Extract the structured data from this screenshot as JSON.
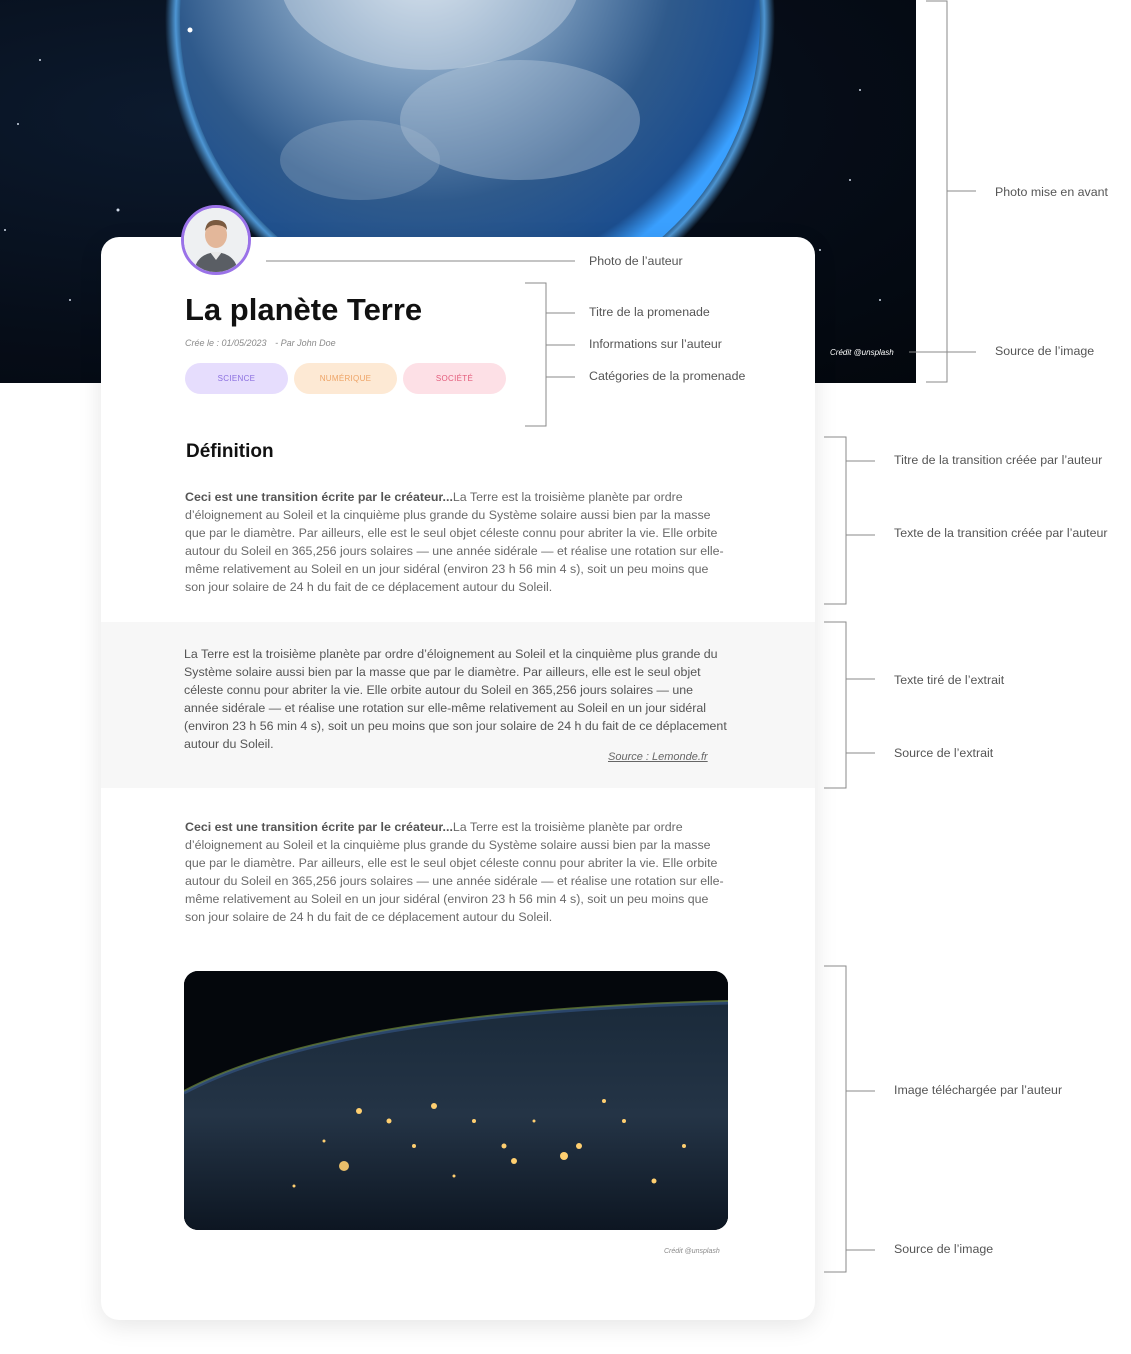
{
  "hero": {
    "credit": "Crédit @unsplash"
  },
  "card": {
    "title": "La planète Terre",
    "meta": {
      "created": "Crée le : 01/05/2023",
      "author": "- Par John Doe"
    },
    "tags": [
      "SCIENCE",
      "NUMÉRIQUE",
      "SOCIÉTÉ"
    ],
    "section_title": "Définition",
    "transition1": {
      "lead": "Ceci est une transition écrite par le créateur...",
      "body": "La Terre est la troisième planète par ordre d’éloignement au Soleil et la cinquième plus grande du Système solaire aussi bien par la masse  que par le diamètre. Par ailleurs, elle est le seul objet céleste connu pour abriter la vie. Elle orbite autour du Soleil en 365,256 jours solaires  — une année sidérale — et réalise une rotation sur elle-même relativement au Soleil en un jour sidéral (environ 23 h 56 min 4 s), soit un peu  moins que son jour solaire de 24 h du fait de ce déplacement autour du Soleil."
    },
    "extract": {
      "text": "La Terre est la troisième planète par ordre d’éloignement au Soleil et la cinquième plus grande du Système solaire aussi bien par la masse  que par le diamètre. Par ailleurs, elle est le seul objet céleste connu pour abriter la vie. Elle orbite autour du Soleil en 365,256 jours solaires  — une année sidérale — et réalise une rotation sur elle-même relativement au Soleil en un jour sidéral (environ 23 h 56 min 4 s), soit un peu  moins que son jour solaire de 24 h du fait de ce déplacement autour du Soleil.",
      "source": "Source : Lemonde.fr"
    },
    "transition2": {
      "lead": "Ceci est une transition écrite par le créateur...",
      "body": "La Terre est la troisième planète par ordre d’éloignement au Soleil et la cinquième plus grande du Système solaire aussi bien par la masse  que par le diamètre. Par ailleurs, elle est le seul objet céleste connu pour abriter la vie. Elle orbite autour du Soleil en 365,256 jours solaires  — une année sidérale — et réalise une rotation sur elle-même relativement au Soleil en un jour sidéral (environ 23 h 56 min 4 s), soit un peu  moins que son jour solaire de 24 h du fait de ce déplacement autour du Soleil."
    },
    "image_credit": "Crédit @unsplash"
  },
  "annotations": {
    "hero_photo": "Photo mise en avant",
    "hero_source": "Source de l’image",
    "author_photo": "Photo de l’auteur",
    "walk_title": "Titre de la promenade",
    "author_info": "Informations sur l’auteur",
    "walk_categories": "Catégories de la promenade",
    "transition_title": "Titre de la transition créée par l’auteur",
    "transition_text": "Texte de la transition créée par l’auteur",
    "extract_text": "Texte tiré de l’extrait",
    "extract_source": "Source de l’extrait",
    "uploaded_image": "Image téléchargée par l’auteur",
    "image_source": "Source de l’image"
  },
  "colors": {
    "tag_science_bg": "#e6ddfd",
    "tag_science_text": "#8b6fe0",
    "tag_numerique_bg": "#fde9d4",
    "tag_numerique_text": "#eea466",
    "tag_societe_bg": "#fde0e6",
    "tag_societe_text": "#e45c7c",
    "avatar_ring": "#9a72e8",
    "extract_band": "#f7f7f7"
  },
  "icons": {
    "hero": "earth-from-space-photo",
    "avatar": "author-portrait-photo",
    "content_image": "earth-at-night-photo"
  }
}
